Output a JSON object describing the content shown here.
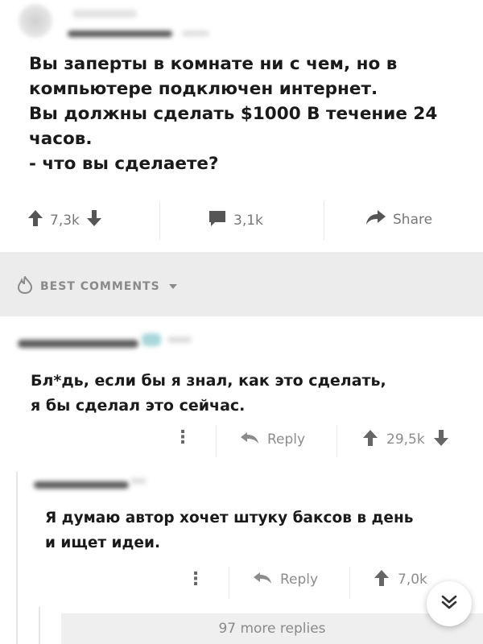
{
  "post": {
    "lines": [
      "Вы заперты в комнате ни с чем, но в",
      "компьютере подключен интернет.",
      "Вы должны сделать $1000 В течение 24",
      "часов.",
      "- что вы сделаете?"
    ],
    "upvotes": "7,3k",
    "comments": "3,1k",
    "share_label": "Share"
  },
  "section": {
    "label": "BEST COMMENTS"
  },
  "comments": [
    {
      "lines": [
        "Бл*дь, если бы я знал, как это сделать,",
        "я бы сделал это сейчас."
      ],
      "reply_label": "Reply",
      "score": "29,5k"
    },
    {
      "lines": [
        "Я думаю автор хочет штуку баксов в день",
        "и ищет идеи."
      ],
      "reply_label": "Reply",
      "score": "7,0k"
    }
  ],
  "more_replies": "97 more replies",
  "colors": {
    "text": "#1a1a1a",
    "muted": "#8c8c8c",
    "band": "#ececec"
  }
}
